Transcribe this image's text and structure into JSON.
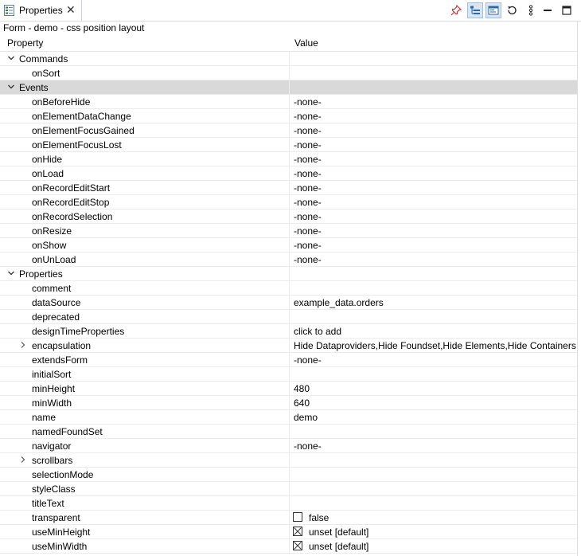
{
  "tab": {
    "title": "Properties",
    "close_glyph": "✕",
    "icon": "properties-view-icon"
  },
  "toolbar": {
    "pin_icon": "pin-icon",
    "categories_icon": "show-categories-icon",
    "advanced_icon": "show-advanced-icon",
    "restore_icon": "restore-default-icon",
    "menu_icon": "view-menu-icon",
    "maximize_icon": "maximize-icon"
  },
  "form_title": "Form - demo - css position layout",
  "columns": {
    "property": "Property",
    "value": "Value"
  },
  "rows": [
    {
      "level": 0,
      "expandable": true,
      "expanded": true,
      "name": "Commands",
      "value": ""
    },
    {
      "level": 1,
      "name": "onSort",
      "value": ""
    },
    {
      "level": 0,
      "expandable": true,
      "expanded": true,
      "name": "Events",
      "value": "",
      "selected": true
    },
    {
      "level": 1,
      "name": "onBeforeHide",
      "value": "-none-"
    },
    {
      "level": 1,
      "name": "onElementDataChange",
      "value": "-none-"
    },
    {
      "level": 1,
      "name": "onElementFocusGained",
      "value": "-none-"
    },
    {
      "level": 1,
      "name": "onElementFocusLost",
      "value": "-none-"
    },
    {
      "level": 1,
      "name": "onHide",
      "value": "-none-"
    },
    {
      "level": 1,
      "name": "onLoad",
      "value": "-none-"
    },
    {
      "level": 1,
      "name": "onRecordEditStart",
      "value": "-none-"
    },
    {
      "level": 1,
      "name": "onRecordEditStop",
      "value": "-none-"
    },
    {
      "level": 1,
      "name": "onRecordSelection",
      "value": "-none-"
    },
    {
      "level": 1,
      "name": "onResize",
      "value": "-none-"
    },
    {
      "level": 1,
      "name": "onShow",
      "value": "-none-"
    },
    {
      "level": 1,
      "name": "onUnLoad",
      "value": "-none-"
    },
    {
      "level": 0,
      "expandable": true,
      "expanded": true,
      "name": "Properties",
      "value": ""
    },
    {
      "level": 1,
      "name": "comment",
      "value": ""
    },
    {
      "level": 1,
      "name": "dataSource",
      "value": "example_data.orders"
    },
    {
      "level": 1,
      "name": "deprecated",
      "value": ""
    },
    {
      "level": 1,
      "name": "designTimeProperties",
      "value": "click to add"
    },
    {
      "level": 1,
      "expandable": true,
      "expanded": false,
      "name": "encapsulation",
      "value": "Hide Dataproviders,Hide Foundset,Hide Elements,Hide Containers"
    },
    {
      "level": 1,
      "name": "extendsForm",
      "value": "-none-"
    },
    {
      "level": 1,
      "name": "initialSort",
      "value": ""
    },
    {
      "level": 1,
      "name": "minHeight",
      "value": "480"
    },
    {
      "level": 1,
      "name": "minWidth",
      "value": "640"
    },
    {
      "level": 1,
      "name": "name",
      "value": "demo"
    },
    {
      "level": 1,
      "name": "namedFoundSet",
      "value": ""
    },
    {
      "level": 1,
      "name": "navigator",
      "value": "-none-"
    },
    {
      "level": 1,
      "expandable": true,
      "expanded": false,
      "name": "scrollbars",
      "value": ""
    },
    {
      "level": 1,
      "name": "selectionMode",
      "value": ""
    },
    {
      "level": 1,
      "name": "styleClass",
      "value": ""
    },
    {
      "level": 1,
      "name": "titleText",
      "value": ""
    },
    {
      "level": 1,
      "name": "transparent",
      "checkbox": "empty",
      "value": "false"
    },
    {
      "level": 1,
      "name": "useMinHeight",
      "checkbox": "crossed",
      "value": "unset [default]"
    },
    {
      "level": 1,
      "name": "useMinWidth",
      "checkbox": "crossed",
      "value": "unset [default]"
    }
  ]
}
